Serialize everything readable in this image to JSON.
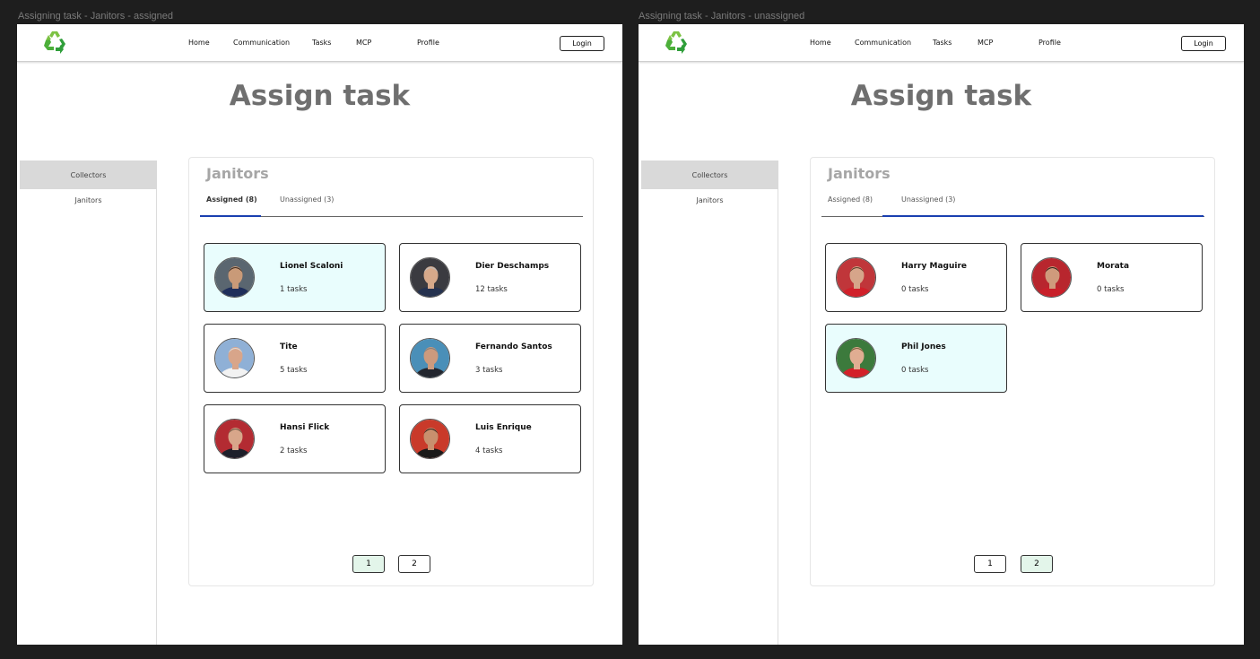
{
  "frames": [
    {
      "label": "Assigning task - Janitors - assigned",
      "nav": {
        "home": "Home",
        "communication": "Communication",
        "tasks": "Tasks",
        "mcp": "MCP",
        "profile": "Profile",
        "login": "Login"
      },
      "title": "Assign task",
      "sidebar": {
        "items": [
          {
            "label": "Collectors",
            "active": true
          },
          {
            "label": "Janitors",
            "active": false
          }
        ]
      },
      "panel": {
        "title": "Janitors",
        "tabs": [
          {
            "label": "Assigned (8)",
            "active": true
          },
          {
            "label": "Unassigned (3)",
            "active": false
          }
        ],
        "cards": [
          {
            "name": "Lionel Scaloni",
            "count": "1 tasks",
            "selected": true,
            "avatar": {
              "skin": "#c99a78",
              "shirt": "#1f2e5a",
              "bg": "#5a6670",
              "hair": "#3a2a20"
            }
          },
          {
            "name": "Dier Deschamps",
            "count": "12 tasks",
            "selected": false,
            "avatar": {
              "skin": "#d6a98a",
              "shirt": "#25324f",
              "bg": "#3b3b40",
              "hair": "#bdbdbd"
            }
          },
          {
            "name": "Tite",
            "count": "5 tasks",
            "selected": false,
            "avatar": {
              "skin": "#d8a58a",
              "shirt": "#f2f2f2",
              "bg": "#8fb0d6",
              "hair": "#dcdcdc"
            }
          },
          {
            "name": "Fernando Santos",
            "count": "3 tasks",
            "selected": false,
            "avatar": {
              "skin": "#cc9a7d",
              "shirt": "#23262e",
              "bg": "#4a8fb8",
              "hair": "#7f7f7f"
            }
          },
          {
            "name": "Hansi Flick",
            "count": "2 tasks",
            "selected": false,
            "avatar": {
              "skin": "#d8a68a",
              "shirt": "#1d1f2a",
              "bg": "#b32b32",
              "hair": "#6a5440"
            }
          },
          {
            "name": "Luis Enrique",
            "count": "4 tasks",
            "selected": false,
            "avatar": {
              "skin": "#c8906e",
              "shirt": "#1a1a1a",
              "bg": "#c93a2a",
              "hair": "#2d221c"
            }
          }
        ],
        "pages": [
          {
            "label": "1",
            "current": true
          },
          {
            "label": "2",
            "current": false
          }
        ]
      }
    },
    {
      "label": "Assigning task - Janitors - unassigned",
      "nav": {
        "home": "Home",
        "communication": "Communication",
        "tasks": "Tasks",
        "mcp": "MCP",
        "profile": "Profile",
        "login": "Login"
      },
      "title": "Assign task",
      "sidebar": {
        "items": [
          {
            "label": "Collectors",
            "active": true
          },
          {
            "label": "Janitors",
            "active": false
          }
        ]
      },
      "panel": {
        "title": "Janitors",
        "tabs": [
          {
            "label": "Assigned (8)",
            "active": false
          },
          {
            "label": "Unassigned (3)",
            "active": true
          }
        ],
        "cards": [
          {
            "name": "Harry Maguire",
            "count": "0 tasks",
            "selected": false,
            "avatar": {
              "skin": "#d6a58a",
              "shirt": "#d0202a",
              "bg": "#c0363a",
              "hair": "#5a3e2a"
            }
          },
          {
            "name": "Morata",
            "count": "0 tasks",
            "selected": false,
            "avatar": {
              "skin": "#cf9a7c",
              "shirt": "#c8202a",
              "bg": "#b8262e",
              "hair": "#2a1e18"
            }
          },
          {
            "name": "Phil Jones",
            "count": "0 tasks",
            "selected": true,
            "avatar": {
              "skin": "#e0ad92",
              "shirt": "#d32029",
              "bg": "#3c7a3c",
              "hair": "#7a5a3a"
            }
          }
        ],
        "pages": [
          {
            "label": "1",
            "current": false
          },
          {
            "label": "2",
            "current": true
          }
        ]
      }
    }
  ],
  "colors": {
    "accent": "#1a3fb0",
    "selected_card": "#e9fdfd",
    "current_page": "#e3f5ea",
    "title": "#6f6f6f"
  },
  "icons": {
    "logo": "recycle-icon"
  }
}
